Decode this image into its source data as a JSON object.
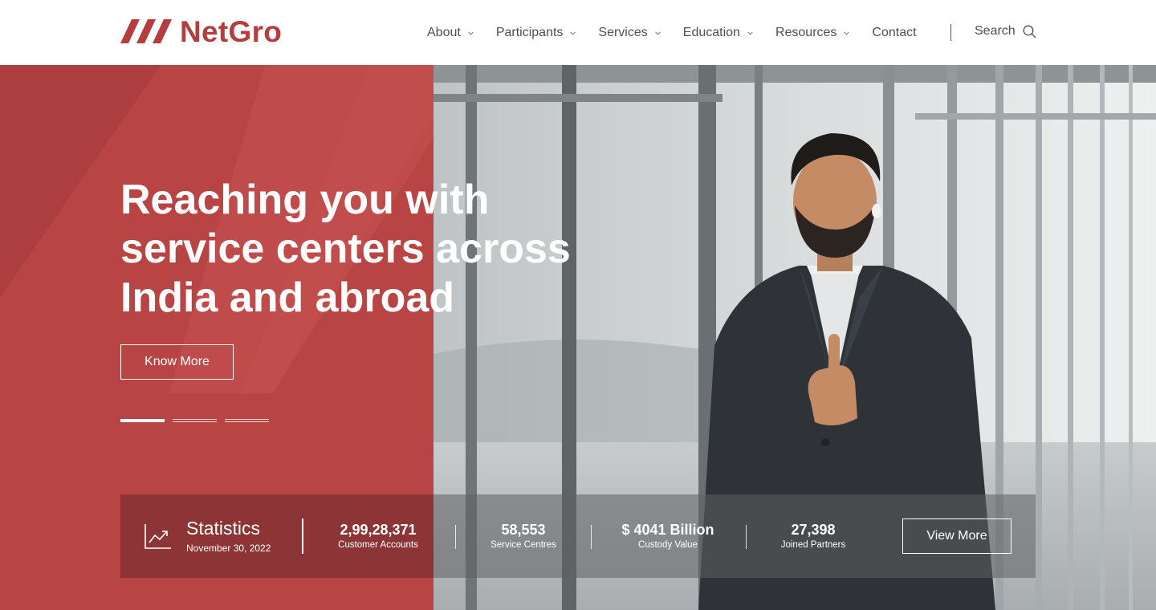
{
  "brand": {
    "name": "NetGro",
    "color": "#b43e3e"
  },
  "nav": {
    "items": [
      {
        "label": "About",
        "has_dropdown": true
      },
      {
        "label": "Participants",
        "has_dropdown": true
      },
      {
        "label": "Services",
        "has_dropdown": true
      },
      {
        "label": "Education",
        "has_dropdown": true
      },
      {
        "label": "Resources",
        "has_dropdown": true
      },
      {
        "label": "Contact",
        "has_dropdown": false
      }
    ],
    "search_label": "Search"
  },
  "hero": {
    "title_lines": [
      "Reaching you with",
      "service centers across",
      "India and abroad"
    ],
    "cta_label": "Know More",
    "slides_total": 3,
    "active_slide": 1,
    "accent_color": "#b94444"
  },
  "stats": {
    "title": "Statistics",
    "date": "November 30, 2022",
    "items": [
      {
        "value": "2,99,28,371",
        "label": "Customer Accounts"
      },
      {
        "value": "58,553",
        "label": "Service Centres"
      },
      {
        "value": "$ 4041 Billion",
        "label": "Custody Value"
      },
      {
        "value": "27,398",
        "label": "Joined Partners"
      }
    ],
    "cta_label": "View More"
  }
}
